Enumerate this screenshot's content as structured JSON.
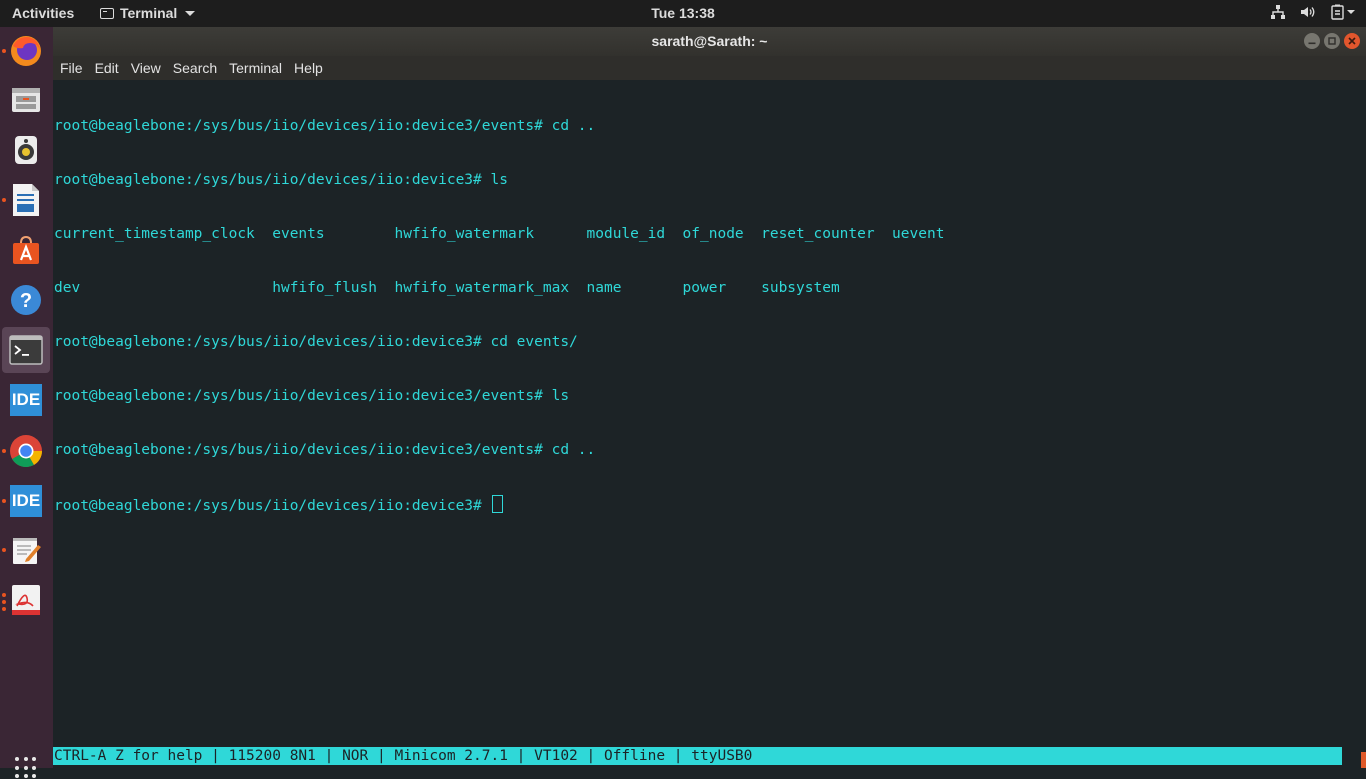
{
  "topbar": {
    "activities": "Activities",
    "app_name": "Terminal",
    "clock": "Tue 13:38"
  },
  "dock": {
    "items": [
      {
        "name": "firefox",
        "running": true
      },
      {
        "name": "files",
        "running": false
      },
      {
        "name": "rhythmbox",
        "running": false
      },
      {
        "name": "libreoffice-writer",
        "running": true
      },
      {
        "name": "software-center",
        "running": false
      },
      {
        "name": "help",
        "running": false
      },
      {
        "name": "terminal",
        "running": true
      },
      {
        "name": "ide",
        "running": false,
        "label": "IDE"
      },
      {
        "name": "chrome",
        "running": true
      },
      {
        "name": "ide-2",
        "running": true,
        "label": "IDE"
      },
      {
        "name": "text-editor",
        "running": true
      },
      {
        "name": "pdf-viewer",
        "running": true
      }
    ]
  },
  "window": {
    "title": "sarath@Sarath: ~",
    "menu": [
      "File",
      "Edit",
      "View",
      "Search",
      "Terminal",
      "Help"
    ]
  },
  "terminal": {
    "lines": [
      "root@beaglebone:/sys/bus/iio/devices/iio:device3/events# cd ..",
      "root@beaglebone:/sys/bus/iio/devices/iio:device3# ls",
      "current_timestamp_clock  events        hwfifo_watermark      module_id  of_node  reset_counter  uevent",
      "dev                      hwfifo_flush  hwfifo_watermark_max  name       power    subsystem",
      "root@beaglebone:/sys/bus/iio/devices/iio:device3# cd events/",
      "root@beaglebone:/sys/bus/iio/devices/iio:device3/events# ls",
      "root@beaglebone:/sys/bus/iio/devices/iio:device3/events# cd ..",
      "root@beaglebone:/sys/bus/iio/devices/iio:device3# "
    ],
    "status": "CTRL-A Z for help | 115200 8N1 | NOR | Minicom 2.7.1 | VT102 | Offline | ttyUSB0"
  },
  "colors": {
    "terminal_fg": "#2fd8d8",
    "terminal_bg": "#1c2326",
    "dock_bg": "#3a2635",
    "accent": "#e95420"
  }
}
